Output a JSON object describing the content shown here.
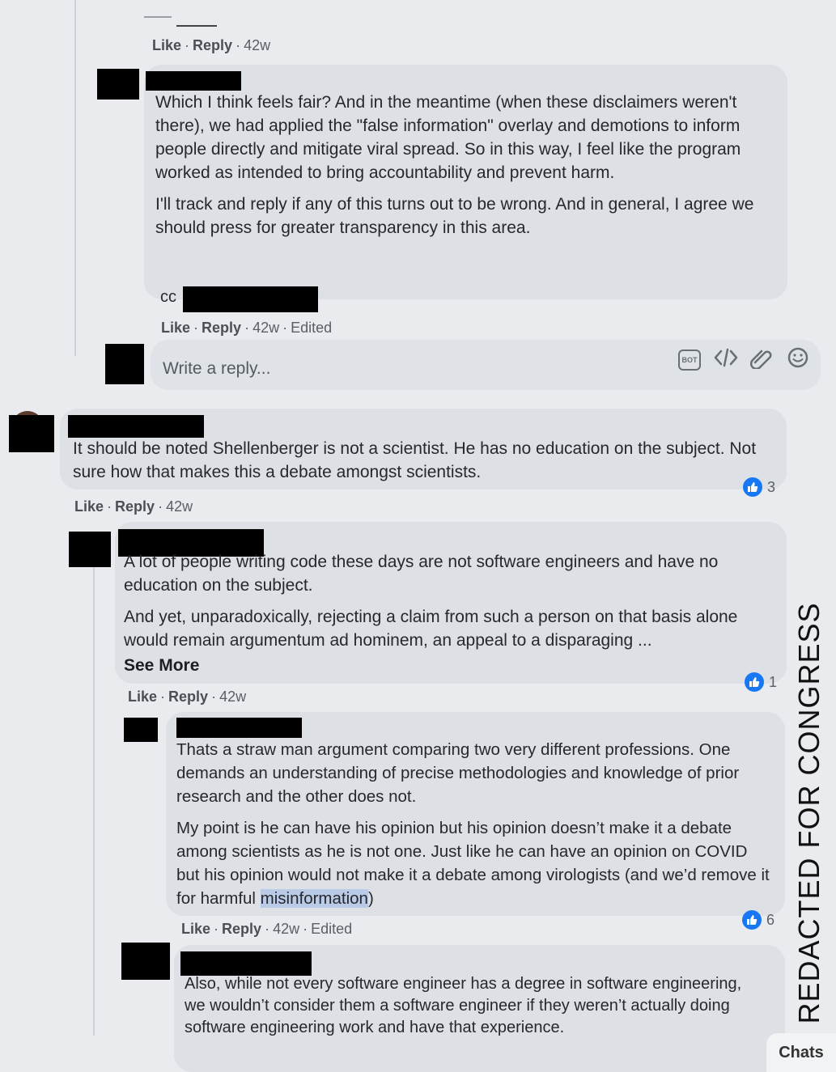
{
  "top_meta": {
    "like": "Like",
    "reply": "Reply",
    "time": "42w"
  },
  "comment1": {
    "paragraphs": [
      "Which I think feels fair? And in the meantime (when these disclaimers weren't there), we had applied the \"false information\" overlay and demotions to inform people directly and mitigate viral spread. So in this way, I feel like the program worked as intended to bring accountability and prevent harm.",
      "I'll track and reply if any of this turns out to be wrong. And in general, I agree we should press for greater transparency in this area."
    ],
    "cc": "cc",
    "meta": {
      "like": "Like",
      "reply": "Reply",
      "time": "42w",
      "edited": "Edited"
    }
  },
  "reply_box": {
    "placeholder": "Write a reply...",
    "icons": [
      "bot-icon",
      "code-icon",
      "attachment-icon",
      "emoji-icon"
    ],
    "bot_label": "BOT"
  },
  "comment2": {
    "text": "It should be noted Shellenberger is not a scientist. He has no education on the subject. Not sure how that makes this a debate amongst scientists.",
    "reactions": "3",
    "meta": {
      "like": "Like",
      "reply": "Reply",
      "time": "42w"
    }
  },
  "comment3": {
    "para1": "A lot of people writing code these days are not software engineers and have no education on the subject.",
    "para2": "And yet, unparadoxically, rejecting a claim from such a person on that basis alone would remain argumentum ad hominem, an appeal to a disparaging ...",
    "see_more": "See More",
    "reactions": "1",
    "meta": {
      "like": "Like",
      "reply": "Reply",
      "time": "42w"
    }
  },
  "comment4": {
    "para1": "Thats a straw man argument comparing two very different professions. One demands an understanding of precise methodologies and knowledge of prior research and the other does not.",
    "para2_before": "My point is he can have his opinion but his opinion doesn’t make it a debate among scientists as he is not one. Just like he can have an opinion on COVID but his opinion would not make it a debate among virologists (and we’d remove it for harmful ",
    "para2_highlight": "misinformation",
    "para2_after": ")",
    "reactions": "6",
    "meta": {
      "like": "Like",
      "reply": "Reply",
      "time": "42w",
      "edited": "Edited"
    }
  },
  "comment5": {
    "text": "Also, while not every software engineer has a degree in software engineering, we wouldn’t consider them a software engineer if they weren’t actually doing software engineering work and have that experience."
  },
  "side_label": "REDACTED FOR CONGRESS",
  "chats_label": "Chats",
  "colors": {
    "like_blue": "#1877f2",
    "bubble": "#dde0e4",
    "background": "#e9ebee"
  }
}
